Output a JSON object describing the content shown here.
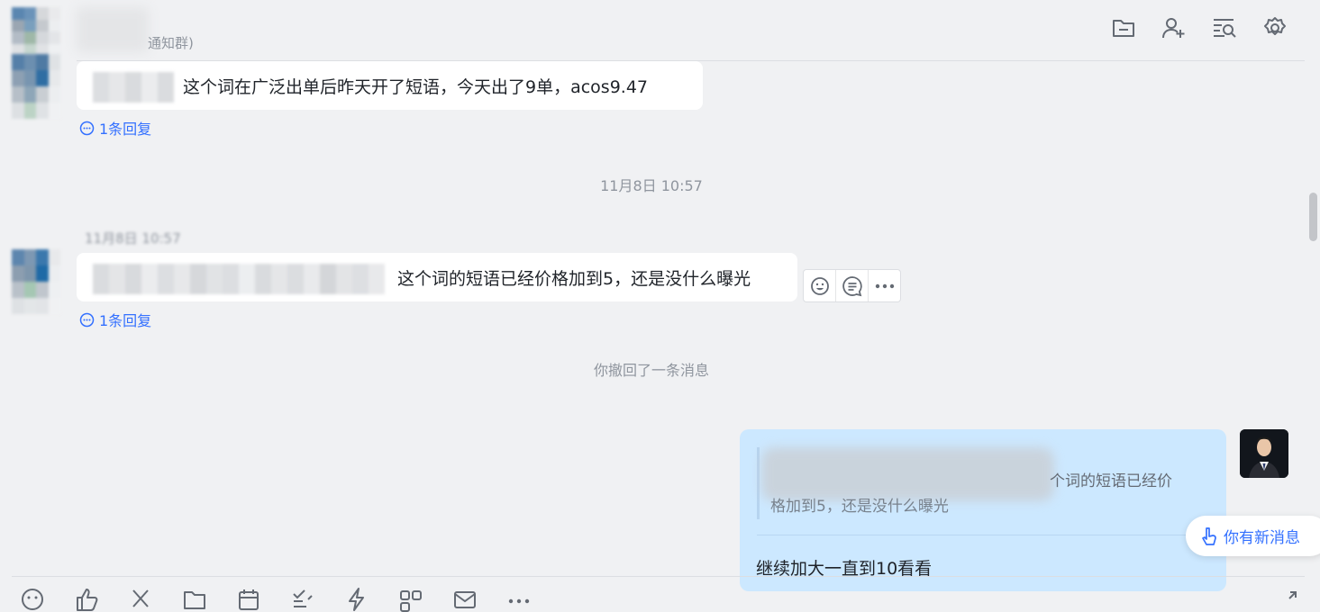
{
  "header": {
    "group_name_suffix": "通知群)"
  },
  "messages": [
    {
      "text": "这个词在广泛出单后昨天开了短语，今天出了9单，acos9.47",
      "reply_link": "1条回复"
    },
    {
      "timestamp": "11月8日 10:57",
      "text": "这个词的短语已经价格加到5，还是没什么曝光",
      "reply_link": "1条回复"
    }
  ],
  "date_separator": "11月8日 10:57",
  "recall_notice": "你撤回了一条消息",
  "my_message": {
    "quote_line1": "个词的短语已经价",
    "quote_line2": "格加到5，还是没什么曝光",
    "text": "继续加大一直到10看看"
  },
  "new_message_pill": "你有新消息",
  "colors": {
    "background": "#f0f1f3",
    "link": "#3370ff",
    "my_bubble": "#cce8ff",
    "muted_text": "#8f959e"
  },
  "icons": {
    "top_toolbar": [
      "folder-icon",
      "add-member-icon",
      "search-history-icon",
      "settings-icon"
    ],
    "hover_actions": [
      "emoji-reaction-icon",
      "reply-thread-icon",
      "more-icon"
    ],
    "composer": [
      "emoji-icon",
      "thumbs-up-icon",
      "scissors-icon",
      "folder-icon",
      "calendar-icon",
      "task-icon",
      "lightning-icon",
      "shortcut-icon",
      "mail-icon",
      "more-icon",
      "expand-icon"
    ]
  }
}
